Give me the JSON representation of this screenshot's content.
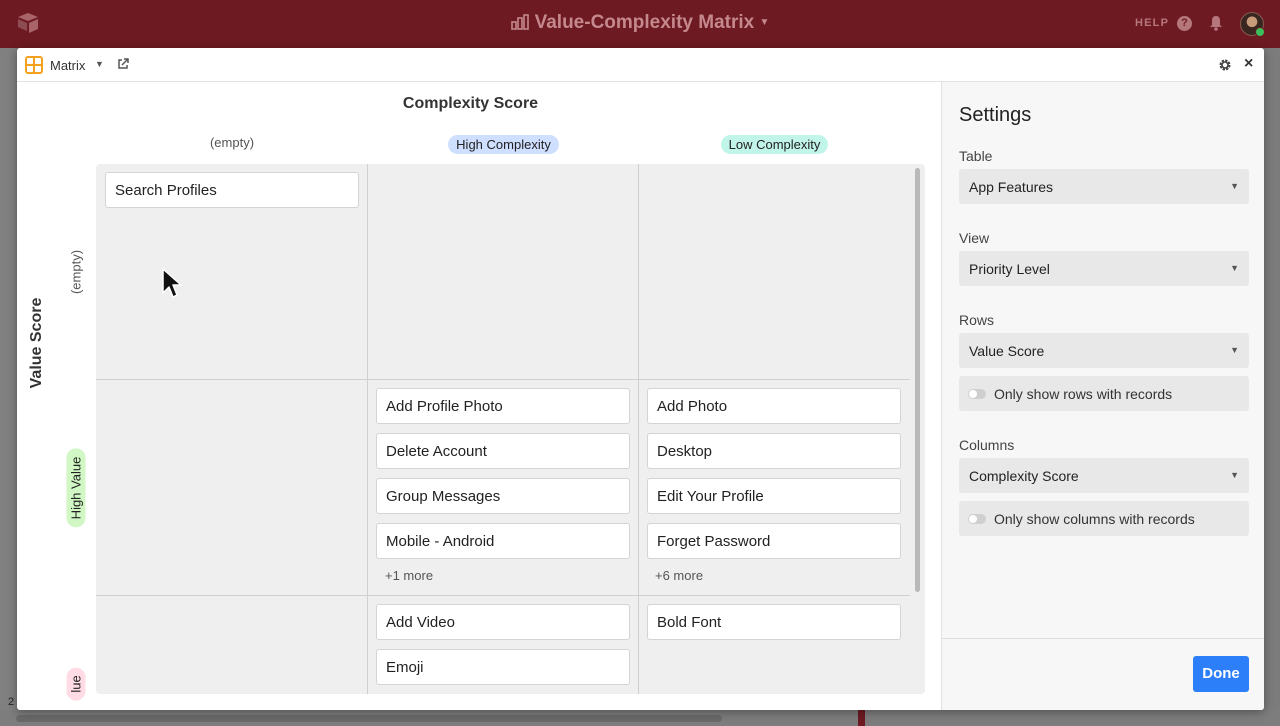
{
  "topbar": {
    "title": "Value-Complexity Matrix",
    "help_label": "HELP"
  },
  "dialog": {
    "app_name": "Matrix",
    "column_field_title": "Complexity Score",
    "row_field_title": "Value Score",
    "columns": [
      {
        "label": "(empty)",
        "color": null
      },
      {
        "label": "High Complexity",
        "color": "#cfdfff"
      },
      {
        "label": "Low Complexity",
        "color": "#c2f5e9"
      }
    ],
    "rows": [
      {
        "label": "(empty)",
        "color": null
      },
      {
        "label": "High Value",
        "color": "#d1f7c4"
      },
      {
        "label": "lue",
        "color": "#ffdce5"
      }
    ],
    "cells": {
      "r0c0": [
        "Search Profiles"
      ],
      "r1c1": [
        "Add Profile Photo",
        "Delete Account",
        "Group Messages",
        "Mobile - Android"
      ],
      "r1c1_more": "+1 more",
      "r1c2": [
        "Add Photo",
        "Desktop",
        "Edit Your Profile",
        "Forget Password"
      ],
      "r1c2_more": "+6 more",
      "r2c1": [
        "Add Video",
        "Emoji"
      ],
      "r2c2": [
        "Bold Font"
      ]
    }
  },
  "settings": {
    "title": "Settings",
    "table_label": "Table",
    "table_value": "App Features",
    "view_label": "View",
    "view_value": "Priority Level",
    "rows_label": "Rows",
    "rows_value": "Value Score",
    "rows_toggle": "Only show rows with records",
    "columns_label": "Columns",
    "columns_value": "Complexity Score",
    "columns_toggle": "Only show columns with records",
    "done_label": "Done"
  },
  "background": {
    "partial_number": "2"
  }
}
